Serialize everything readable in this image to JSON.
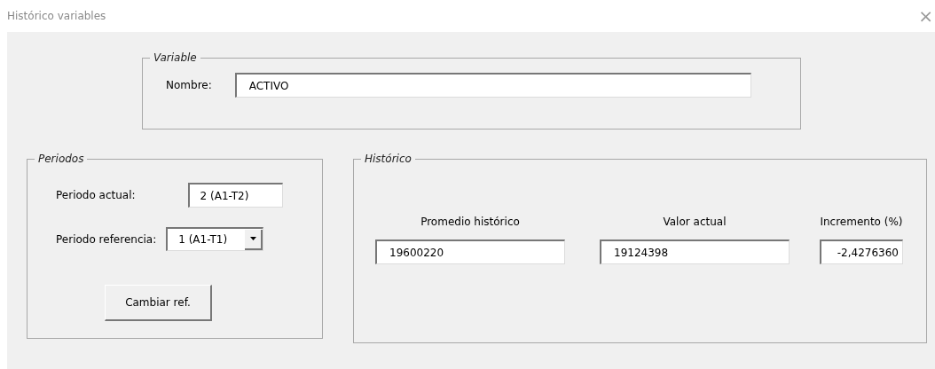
{
  "window": {
    "title": "Histórico variables",
    "close": "×"
  },
  "variable": {
    "legend": "Variable",
    "label": "Nombre:",
    "value": "ACTIVO"
  },
  "periodos": {
    "legend": "Periodos",
    "actual_label": "Periodo actual:",
    "actual_value": "2 (A1-T2)",
    "referencia_label": "Periodo referencia:",
    "referencia_value": "1 (A1-T1)",
    "button": "Cambiar ref."
  },
  "historico": {
    "legend": "Histórico",
    "columns": [
      {
        "label": "Promedio histórico",
        "value": "19600220",
        "right_aligned": false
      },
      {
        "label": "Valor actual",
        "value": "19124398",
        "right_aligned": false
      },
      {
        "label": "Incremento (%)",
        "value": "-2,4276360",
        "right_aligned": true
      }
    ]
  }
}
